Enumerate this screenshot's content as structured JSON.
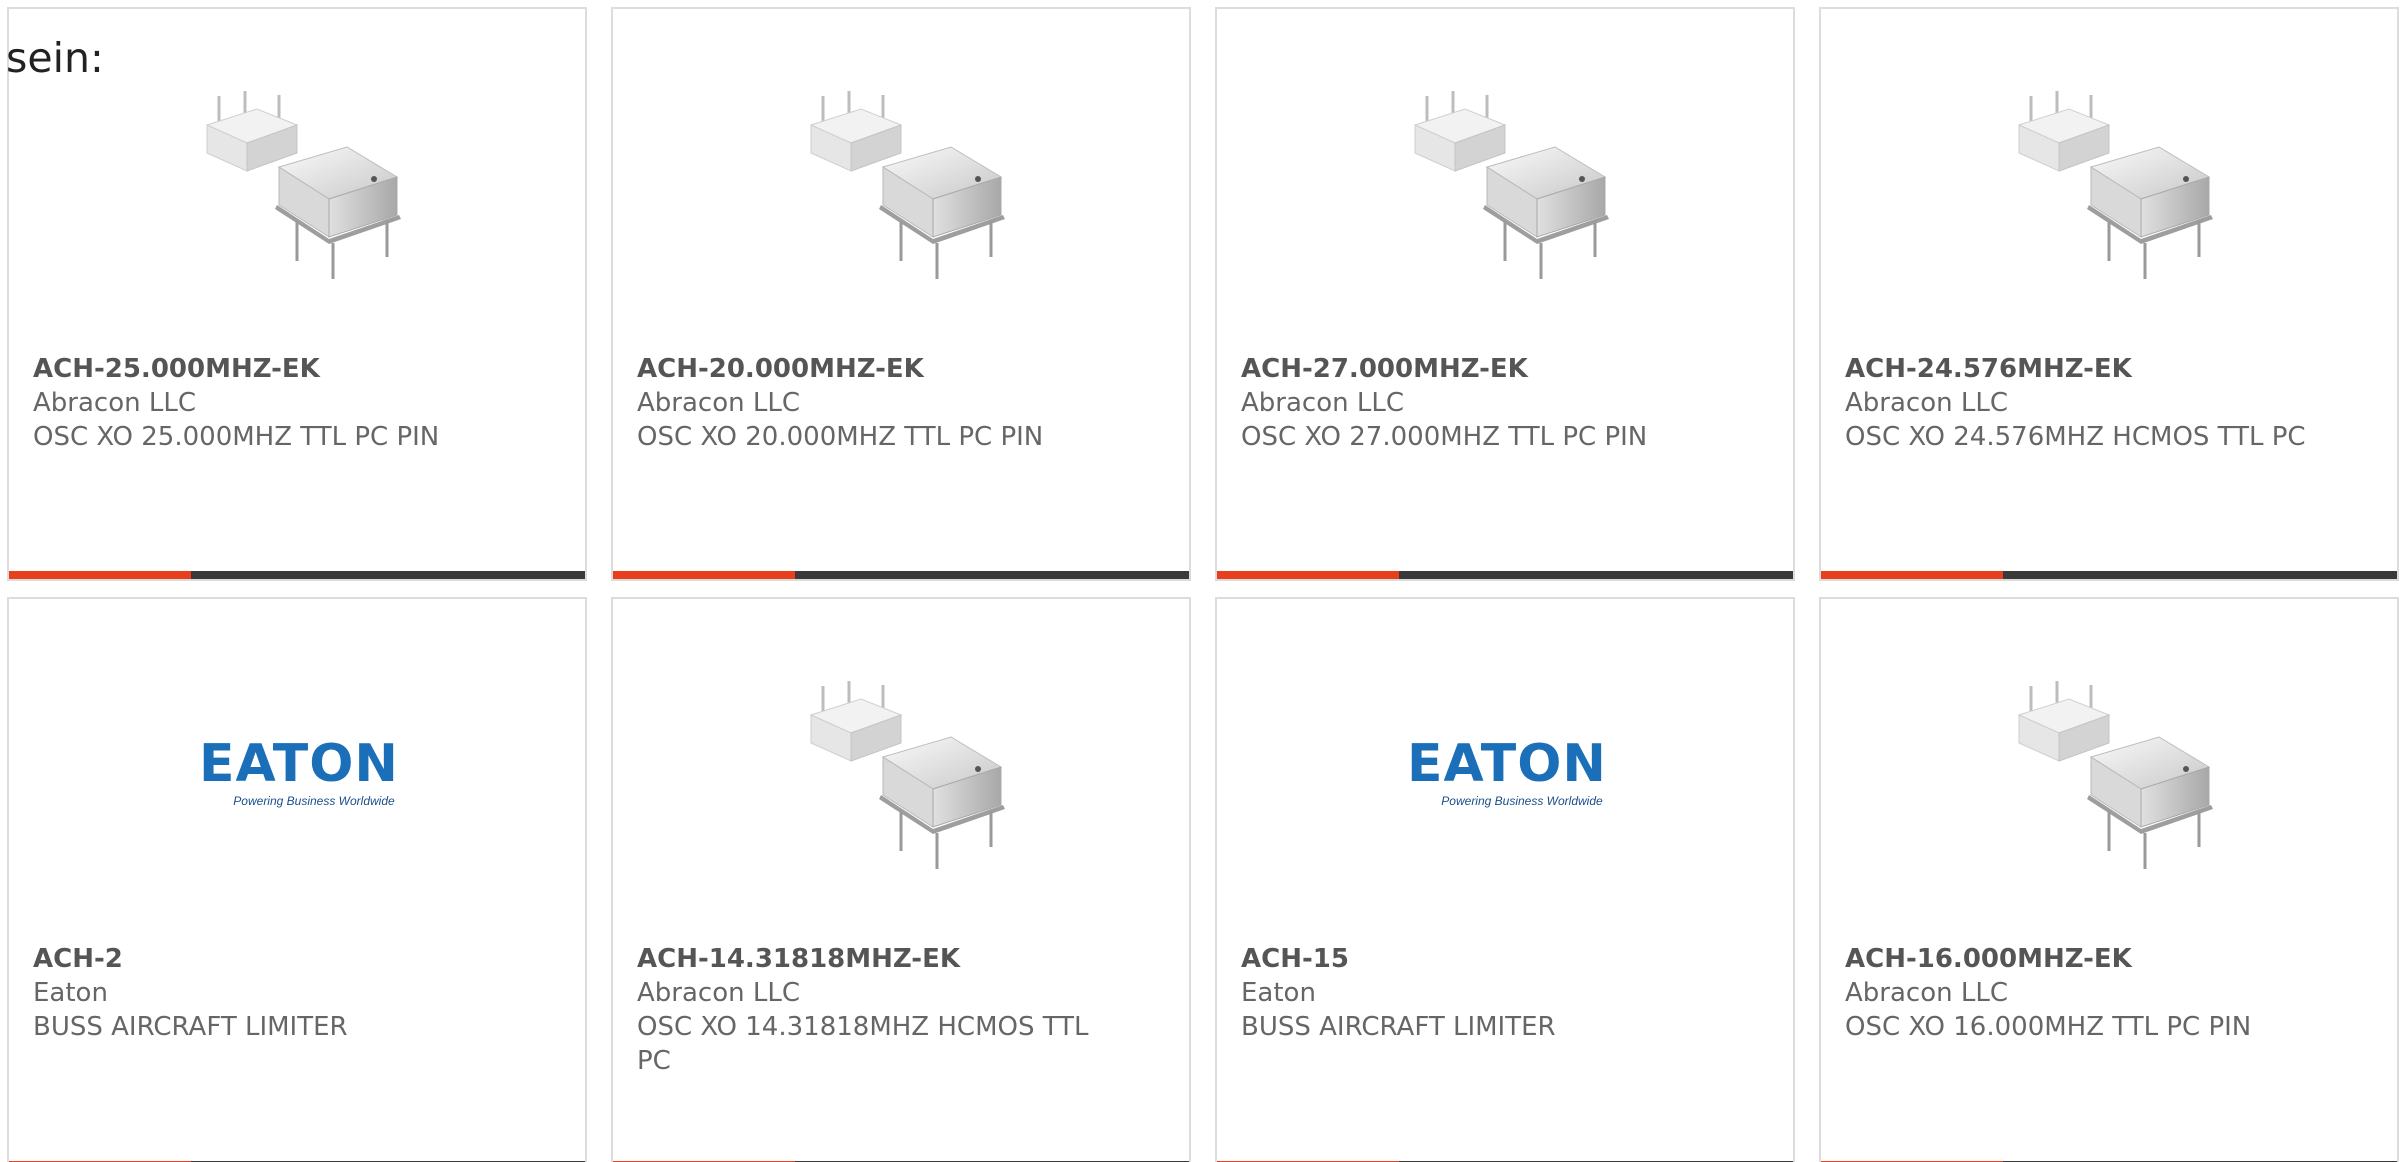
{
  "intro_text": "sein:",
  "colors": {
    "card_border": "#dcdcdc",
    "bar_accent": "#e8401c",
    "bar_dark": "#3a3a3a",
    "text_gray": "#666666",
    "eaton_blue": "#1a6fb8"
  },
  "products": [
    {
      "part_number": "ACH-25.000MHZ-EK",
      "manufacturer": "Abracon LLC",
      "description": "OSC XO 25.000MHZ TTL PC PIN",
      "image": "oscillator-product-image"
    },
    {
      "part_number": "ACH-20.000MHZ-EK",
      "manufacturer": "Abracon LLC",
      "description": "OSC XO 20.000MHZ TTL PC PIN",
      "image": "oscillator-product-image"
    },
    {
      "part_number": "ACH-27.000MHZ-EK",
      "manufacturer": "Abracon LLC",
      "description": "OSC XO 27.000MHZ TTL PC PIN",
      "image": "oscillator-product-image"
    },
    {
      "part_number": "ACH-24.576MHZ-EK",
      "manufacturer": "Abracon LLC",
      "description": "OSC XO 24.576MHZ HCMOS TTL PC",
      "image": "oscillator-product-image"
    },
    {
      "part_number": "ACH-2",
      "manufacturer": "Eaton",
      "description": "BUSS AIRCRAFT LIMITER",
      "image": "eaton-logo",
      "logo_word": "EATON",
      "logo_tagline": "Powering Business Worldwide"
    },
    {
      "part_number": "ACH-14.31818MHZ-EK",
      "manufacturer": "Abracon LLC",
      "description": "OSC XO 14.31818MHZ HCMOS TTL PC",
      "image": "oscillator-product-image"
    },
    {
      "part_number": "ACH-15",
      "manufacturer": "Eaton",
      "description": "BUSS AIRCRAFT LIMITER",
      "image": "eaton-logo",
      "logo_word": "EATON",
      "logo_tagline": "Powering Business Worldwide"
    },
    {
      "part_number": "ACH-16.000MHZ-EK",
      "manufacturer": "Abracon LLC",
      "description": "OSC XO 16.000MHZ TTL PC PIN",
      "image": "oscillator-product-image"
    }
  ]
}
